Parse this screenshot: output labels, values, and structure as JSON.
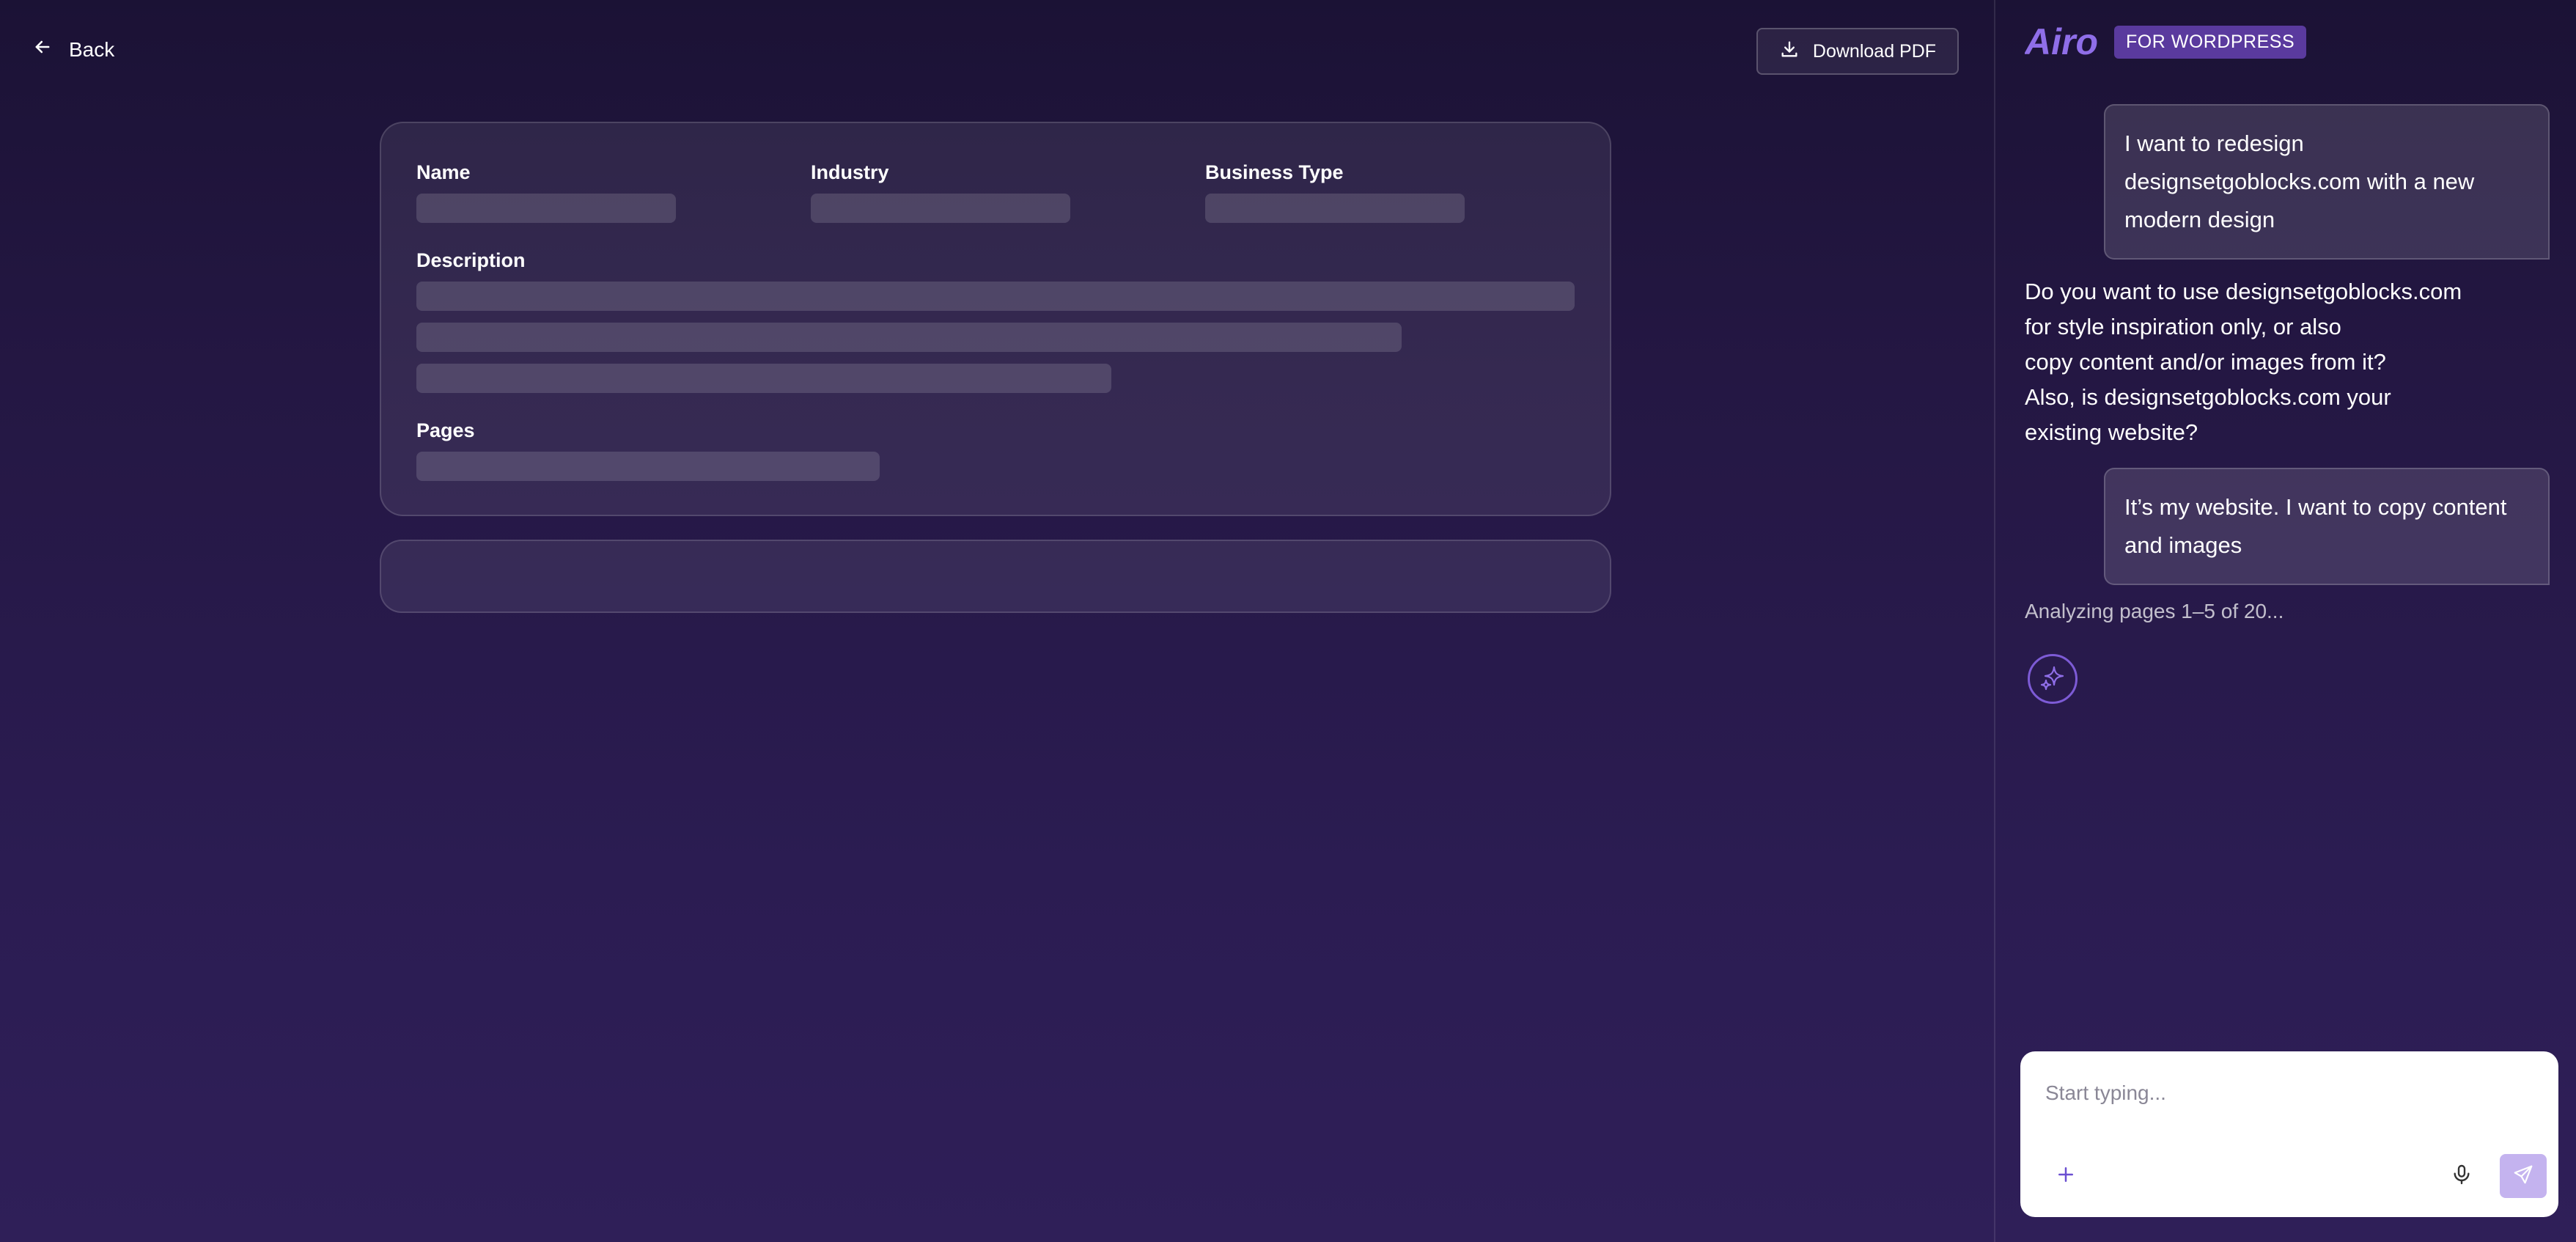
{
  "header": {
    "back_label": "Back",
    "download_label": "Download PDF"
  },
  "summary": {
    "name_label": "Name",
    "industry_label": "Industry",
    "business_type_label": "Business Type",
    "description_label": "Description",
    "pages_label": "Pages"
  },
  "chat": {
    "brand_name": "Airo",
    "brand_badge": "FOR WORDPRESS",
    "messages": [
      {
        "role": "user",
        "text": "I want to redesign\ndesignsetgoblocks.com with a new\nmodern design"
      },
      {
        "role": "assistant",
        "text": "Do you want to use designsetgoblocks.com\nfor style inspiration only, or also\ncopy content and/or images from it?\nAlso, is designsetgoblocks.com your\nexisting website?"
      },
      {
        "role": "user",
        "text": "It’s my website. I want to copy content\nand images"
      }
    ],
    "status": "Analyzing pages 1–5 of 20...",
    "composer": {
      "placeholder": "Start typing..."
    }
  },
  "colors": {
    "background_top": "#1b1235",
    "background_bottom": "#2f1f58",
    "brand_accent": "#7d5bd6",
    "badge_bg": "#5a3a9e",
    "send_button": "#c4b3ef"
  },
  "icons": [
    "arrow-left-icon",
    "download-icon",
    "sparkle-icon",
    "plus-icon",
    "microphone-icon",
    "send-icon"
  ]
}
